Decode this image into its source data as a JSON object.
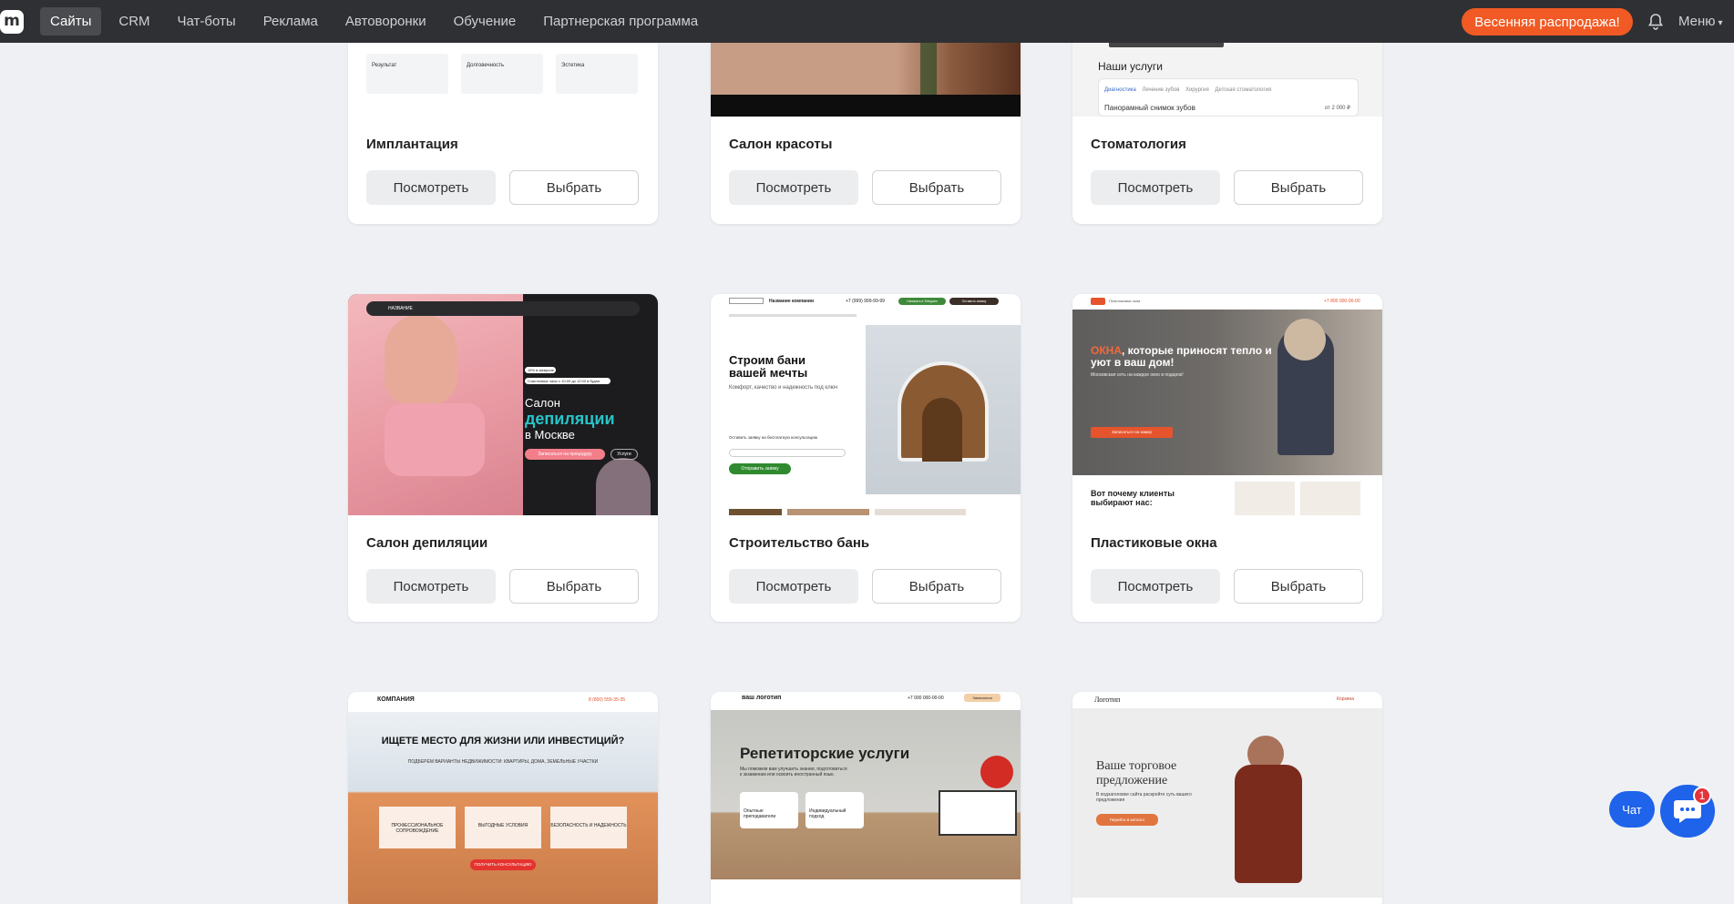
{
  "nav": {
    "logo_letter": "m",
    "items": [
      {
        "label": "Сайты",
        "active": true
      },
      {
        "label": "CRM"
      },
      {
        "label": "Чат-боты"
      },
      {
        "label": "Реклама"
      },
      {
        "label": "Автоворонки"
      },
      {
        "label": "Обучение"
      },
      {
        "label": "Партнерская программа"
      }
    ],
    "sale_label": "Весенняя распродажа!",
    "menu_label": "Меню"
  },
  "cards": [
    {
      "title": "Имплантация",
      "view": "Посмотреть",
      "pick": "Выбрать",
      "preview": {
        "labels": [
          "Результат",
          "Долговечность",
          "Эстетика"
        ]
      }
    },
    {
      "title": "Салон красоты",
      "view": "Посмотреть",
      "pick": "Выбрать"
    },
    {
      "title": "Стоматология",
      "view": "Посмотреть",
      "pick": "Выбрать",
      "preview": {
        "heading": "Наши услуги",
        "tabs": [
          "Диагностика",
          "Лечение зубов",
          "Хирургия",
          "Детская стоматология"
        ],
        "row": "Панорамный снимок зубов",
        "price": "от 2 000 ₽"
      }
    },
    {
      "title": "Салон депиляции",
      "view": "Посмотреть",
      "pick": "Выбрать",
      "preview": {
        "brand": "НАЗВАНИЕ",
        "line1": "Салон",
        "line2": "депиляции",
        "line3": "в Москве",
        "cta": "Записаться на процедуру",
        "cta2": "Услуги",
        "badge1": "15% в феврале",
        "badge2": "Счастливые часы с 10:00 до 12:00 в будни"
      }
    },
    {
      "title": "Строительство бань",
      "view": "Посмотреть",
      "pick": "Выбрать",
      "preview": {
        "company": "Название компании",
        "phone": "+7 (999) 999-99-99",
        "btn1": "Написать в Telegram",
        "btn2": "Оставить заявку",
        "heading": "Строим бани вашей мечты",
        "sub": "Комфорт, качество и надежность под ключ",
        "form_label": "Оставить заявку на бесплатную консультацию",
        "submit": "Отправить заявку"
      }
    },
    {
      "title": "Пластиковые окна",
      "view": "Посмотреть",
      "pick": "Выбрать",
      "preview": {
        "brand": "Пластиковые окна",
        "phone": "+7 800 000-00-00",
        "accent": "ОКНА",
        "heading": ", которые приносят тепло и уют в ваш дом!",
        "sub": "Московская сеть на каждое окно в подарок!",
        "cta": "Записаться на замер",
        "why": "Вот почему клиенты выбирают нас:"
      }
    },
    {
      "title": "",
      "view": "",
      "pick": "",
      "preview": {
        "brand": "КОМПАНИЯ",
        "phone": "8 (800) 555-35-35",
        "heading": "ИЩЕТЕ МЕСТО ДЛЯ ЖИЗНИ ИЛИ ИНВЕСТИЦИЙ?",
        "sub": "ПОДБЕРЕМ ВАРИАНТЫ НЕДВИЖИМОСТИ: КВАРТИРЫ, ДОМА, ЗЕМЕЛЬНЫЕ УЧАСТКИ",
        "features": [
          "ПРОФЕССИОНАЛЬНОЕ СОПРОВОЖДЕНИЕ",
          "ВЫГОДНЫЕ УСЛОВИЯ",
          "БЕЗОПАСНОСТЬ И НАДЕЖНОСТЬ"
        ],
        "cta": "ПОЛУЧИТЬ КОНСУЛЬТАЦИЮ"
      }
    },
    {
      "title": "",
      "view": "",
      "pick": "",
      "preview": {
        "brand": "ваш логотип",
        "phone": "+7 000 000-00-00",
        "btn": "Записаться",
        "heading": "Репетиторские услуги",
        "sub": "Мы поможем вам улучшить знания, подготовиться к экзаменам или освоить иностранный язык.",
        "f1": "Опытные преподаватели",
        "f2": "Индивидуальный подход"
      }
    },
    {
      "title": "",
      "view": "",
      "pick": "",
      "preview": {
        "brand": "Логотип",
        "cart": "Корзина",
        "heading1": "Ваше торговое",
        "heading2": "предложение",
        "sub": "В подзаголовке сайта раскройте суть вашего предложения",
        "cta": "Перейти в каталог"
      }
    }
  ],
  "chat": {
    "label": "Чат",
    "badge": "1"
  }
}
